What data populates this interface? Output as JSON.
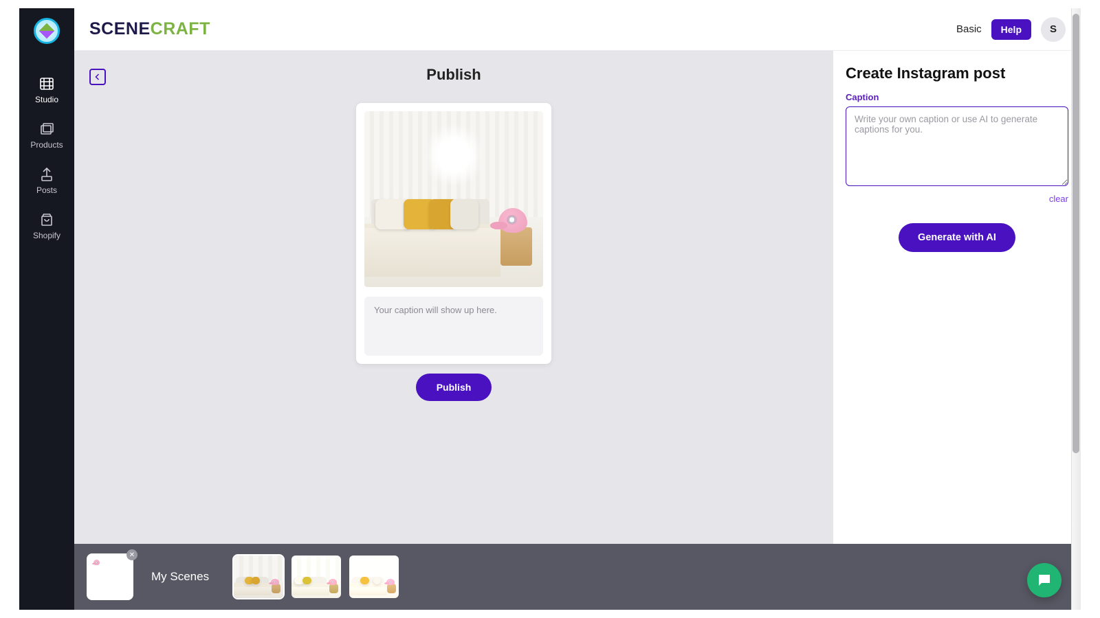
{
  "brand": {
    "part1": "SCENE",
    "part2": "CRAFT"
  },
  "header": {
    "plan": "Basic",
    "help": "Help",
    "avatar_initial": "S"
  },
  "sidebar": {
    "items": [
      {
        "id": "studio",
        "label": "Studio",
        "active": true
      },
      {
        "id": "products",
        "label": "Products",
        "active": false
      },
      {
        "id": "posts",
        "label": "Posts",
        "active": false
      },
      {
        "id": "shopify",
        "label": "Shopify",
        "active": false
      }
    ]
  },
  "canvas": {
    "title": "Publish",
    "caption_preview": "Your caption will show up here.",
    "publish_button": "Publish"
  },
  "panel": {
    "title": "Create Instagram post",
    "caption_label": "Caption",
    "caption_placeholder": "Write your own caption or use AI to generate captions for you.",
    "clear": "clear",
    "generate": "Generate with AI"
  },
  "tray": {
    "label": "My Scenes",
    "scene_count": 3,
    "selected_index": 0
  }
}
